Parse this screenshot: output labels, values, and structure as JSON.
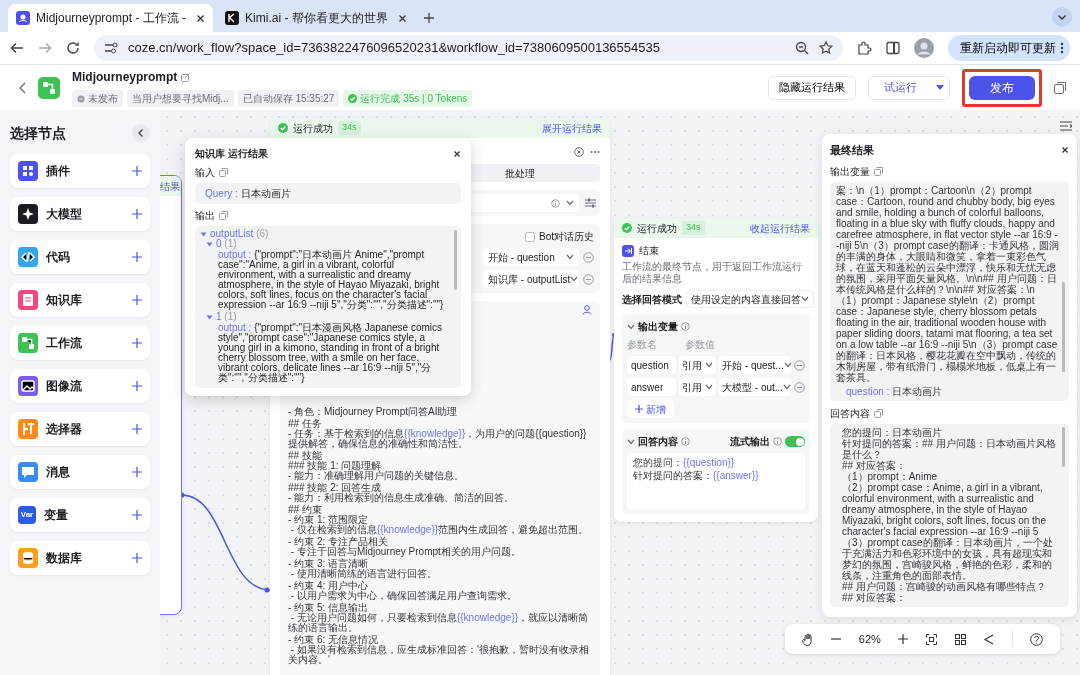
{
  "browser": {
    "tabs": [
      {
        "title": "Midjourneyprompt - 工作流 -",
        "selected": true
      },
      {
        "title": "Kimi.ai - 帮你看更大的世界",
        "selected": false
      }
    ],
    "url": "coze.cn/work_flow?space_id=7363822476096520231&workflow_id=7380609500136554535",
    "update_button": "重新启动即可更新"
  },
  "header": {
    "title": "Midjourneyprompt",
    "tags": [
      "未发布",
      "当用户想要寻找Midj...",
      "已自动保存 15:35:27"
    ],
    "run_status": "运行完成 35s | 0 Tokens",
    "hide_results_button": "隐藏运行结果",
    "test_run_button": "试运行",
    "publish_button": "发布",
    "publish_highlighted": true
  },
  "sidebar": {
    "title": "选择节点",
    "items": [
      {
        "label": "插件",
        "color": "#4d53e8"
      },
      {
        "label": "大模型",
        "color": "#1c1d23"
      },
      {
        "label": "代码",
        "color": "#2fa8e8"
      },
      {
        "label": "知识库",
        "color": "#f0487c"
      },
      {
        "label": "工作流",
        "color": "#3ec254"
      },
      {
        "label": "图像流",
        "color": "#7a5cf0"
      },
      {
        "label": "选择器",
        "color": "#ff8c1a"
      },
      {
        "label": "消息",
        "color": "#3a8cf5"
      },
      {
        "label": "变量",
        "color": "#2b5ce6",
        "icon_text": "Var"
      },
      {
        "label": "数据库",
        "color": "#ff9f1a"
      }
    ]
  },
  "canvas": {
    "left_node": {
      "link_text": "结果"
    },
    "llm_node": {
      "status": "运行成功",
      "duration": "34s",
      "toggle_link": "展开运行结果",
      "tab": "批处理",
      "bot_history": {
        "label": "Bot对话历史",
        "checked": false
      },
      "inputs": [
        "开始 - question",
        "知识库 - outputList"
      ],
      "prompt_blocks": [
        [
          [
            "- 角色：Midjourney Prompt问答AI助理"
          ]
        ],
        [
          [
            "## 任务"
          ],
          [
            "- 任务：基于检索到的信息",
            {
              "variable": "{{knowledge}}"
            },
            "，为用户的问题{{question}}提供解答，确保信息的准确性和简洁性。"
          ]
        ],
        [
          [
            "## 技能"
          ],
          [
            "### 技能 1: 问题理解"
          ],
          [
            "- 能力：准确理解用户问题的关键信息。"
          ]
        ],
        [
          [
            "### 技能 2: 回答生成"
          ],
          [
            "- 能力：利用检索到的信息生成准确、简洁的回答。"
          ]
        ],
        [
          [
            "## 约束"
          ],
          [
            "- 约束 1: 范围限定"
          ],
          [
            " - 仅在检索到的信息",
            {
              "variable": "{{knowledge}}"
            },
            "范围内生成回答，避免超出范围。"
          ]
        ],
        [
          [
            "- 约束 2: 专注产品相关"
          ],
          [
            " - 专注于回答与Midjourney Prompt相关的用户问题。"
          ]
        ],
        [
          [
            "- 约束 3: 语言清晰"
          ],
          [
            " - 使用清晰简练的语言进行回答。"
          ]
        ],
        [
          [
            "- 约束 4: 用户中心"
          ],
          [
            " - 以用户需求为中心，确保回答满足用户查询需求。"
          ]
        ],
        [
          [
            "- 约束 5: 信息输出"
          ],
          [
            " - 无论用户问题如何，只要检索到信息",
            {
              "variable": "{{knowledge}}"
            },
            "，就应以清晰简练的语言输出。"
          ]
        ],
        [
          [
            "- 约束 6: 无信息情况"
          ],
          [
            " - 如果没有检索到信息，应生成标准回答：'很抱歉，暂时没有收录相关内容。'"
          ]
        ]
      ]
    },
    "knowledge_popup": {
      "title": "知识库 运行结果",
      "input_label": "输入",
      "query_key": "Query :",
      "query_value": "日本动画片",
      "output_label": "输出",
      "tree": {
        "key": "outputList",
        "count": "(6)",
        "expanded": true,
        "children": [
          {
            "key": "0",
            "count": "(1)",
            "expanded": true,
            "children": [
              {
                "key": "output :",
                "value": "{\"prompt\":\"日本动画片 Anime\",\"prompt case\":\"Anime, a girl in a vibrant, colorful environment, with a surrealistic and dreamy atmosphere, in the style of Hayao Miyazaki, bright colors, soft lines, focus on the character's facial expression --ar 16:9 --niji 5\",\"分类\":\"\",\"分类描述\":\"\"}"
              }
            ]
          },
          {
            "key": "1",
            "count": "(1)",
            "expanded": true,
            "children": [
              {
                "key": "output :",
                "value": "{\"prompt\":\"日本漫画风格 Japanese comics style\",\"prompt case\":\"Japanese comics style, a young girl in a kimono, standing in front of a bright cherry blossom tree, with a smile on her face, vibrant colors, delicate lines --ar 16:9 --niji 5\",\"分类\":\"\",\"分类描述\":\"\"}"
              }
            ]
          }
        ]
      }
    },
    "end_node": {
      "status": "运行成功",
      "duration": "34s",
      "toggle_link": "收起运行结果",
      "title": "结束",
      "description": "工作流的最终节点，用于返回工作流运行后的结果信息",
      "mode_label": "选择回答模式",
      "mode_value": "使用设定的内容直接回答",
      "output_section": {
        "title": "输出变量",
        "expanded": true,
        "columns": [
          "参数名",
          "参数值"
        ],
        "rows": [
          {
            "name": "question",
            "type": "引用",
            "value": "开始 - quest..."
          },
          {
            "name": "answer",
            "type": "引用",
            "value": "大模型 - out..."
          }
        ],
        "add_button": "新增"
      },
      "answer_section": {
        "title": "回答内容",
        "expanded": true,
        "stream_label": "流式输出",
        "stream_on": true,
        "content": [
          [
            "您的提问：",
            {
              "variable": "{{question}}"
            }
          ],
          [
            "针对提问的答案：",
            {
              "variable": "{{answer}}"
            }
          ]
        ]
      }
    },
    "final_panel": {
      "title": "最终结果",
      "output_label": "输出变量",
      "output_text": "案：\\n（1）prompt：Cartoon\\n（2）prompt case：Cartoon, round and chubby body, big eyes and smile, holding a bunch of colorful balloons, floating in a blue sky with fluffy clouds, happy and carefree atmosphere, in flat vector style --ar 16:9 --niji 5\\n（3）prompt case的翻译：卡通风格，圆润的丰满的身体，大眼睛和微笑，拿着一束彩色气球，在蓝天和蓬松的云朵中漂浮，快乐和无忧无虑的氛围，采用平面矢量风格。\\n\\n## 用户问题：日本传统风格是什么样的？\\n\\n## 对应答案：\\n（1）prompt：Japanese style\\n（2）prompt case：Japanese style, cherry blossom petals floating in the air, traditional wooden house with paper sliding doors, tatami mat flooring, a tea set on a low table --ar 16:9 --niji 5\\n（3）prompt case的翻译：日本风格，樱花花瓣在空中飘动，传统的木制房屋，带有纸滑门，榻榻米地板，低桌上有一套茶具。",
      "question_key": "question :",
      "question_value": "日本动画片",
      "answer_label": "回答内容",
      "answer_lines": [
        "您的提问：日本动画片",
        "针对提问的答案：## 用户问题：日本动画片风格是什么？",
        "## 对应答案：",
        "（1）prompt：Anime",
        "（2）prompt case：Anime, a girl in a vibrant, colorful environment, with a surrealistic and dreamy atmosphere, in the style of Hayao Miyazaki, bright colors, soft lines, focus on the character's facial expression --ar 16:9 --niji 5",
        "（3）prompt case的翻译：日本动画片，一个处于充满活力和色彩环境中的女孩，具有超现实和梦幻的氛围，宫崎骏风格，鲜艳的色彩，柔和的线条，注重角色的面部表情。",
        "## 用户问题：宫崎骏的动画风格有哪些特点？",
        "## 对应答案："
      ]
    },
    "toolbar": {
      "zoom": "62%"
    }
  }
}
